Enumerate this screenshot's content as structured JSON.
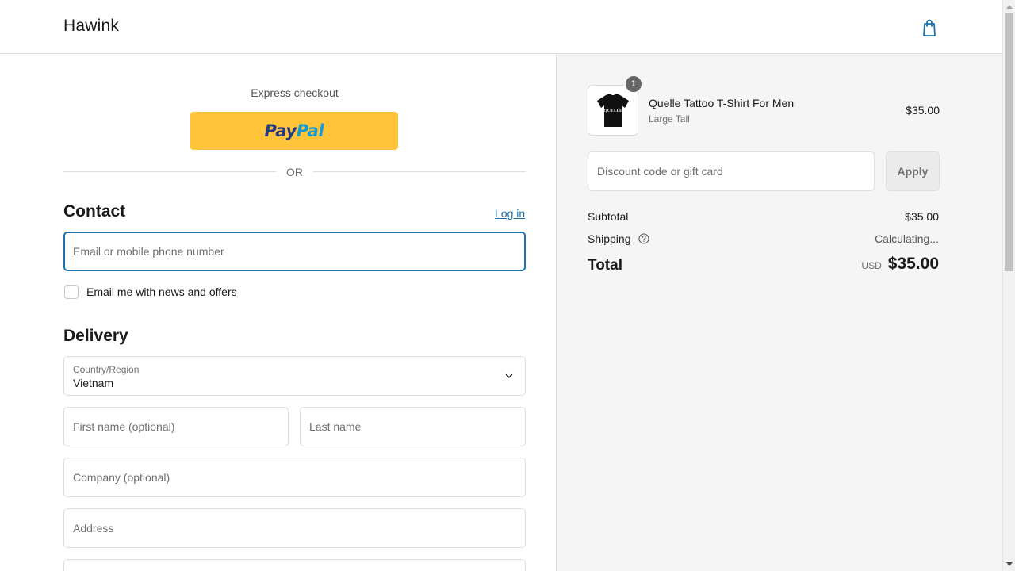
{
  "header": {
    "brand": "Hawink",
    "cart_icon": "shopping-bag-icon",
    "accent_color": "#1773b0"
  },
  "express": {
    "label": "Express checkout",
    "paypal_pay": "Pay",
    "paypal_pal": "Pal",
    "paypal_color": "#ffc439",
    "or_text": "OR"
  },
  "contact": {
    "title": "Contact",
    "login_link": "Log in",
    "email_placeholder": "Email or mobile phone number",
    "newsletter_label": "Email me with news and offers",
    "newsletter_checked": false
  },
  "delivery": {
    "title": "Delivery",
    "country_label": "Country/Region",
    "country_value": "Vietnam",
    "first_name_placeholder": "First name (optional)",
    "last_name_placeholder": "Last name",
    "company_placeholder": "Company (optional)",
    "address_placeholder": "Address"
  },
  "summary": {
    "product": {
      "name": "Quelle Tattoo T-Shirt For Men",
      "variant": "Large Tall",
      "price": "$35.00",
      "quantity": "1",
      "shirt_print": "QUELLE"
    },
    "discount_placeholder": "Discount code or gift card",
    "apply_label": "Apply",
    "subtotal_label": "Subtotal",
    "subtotal_value": "$35.00",
    "shipping_label": "Shipping",
    "shipping_value": "Calculating...",
    "total_label": "Total",
    "total_currency": "USD",
    "total_value": "$35.00"
  }
}
